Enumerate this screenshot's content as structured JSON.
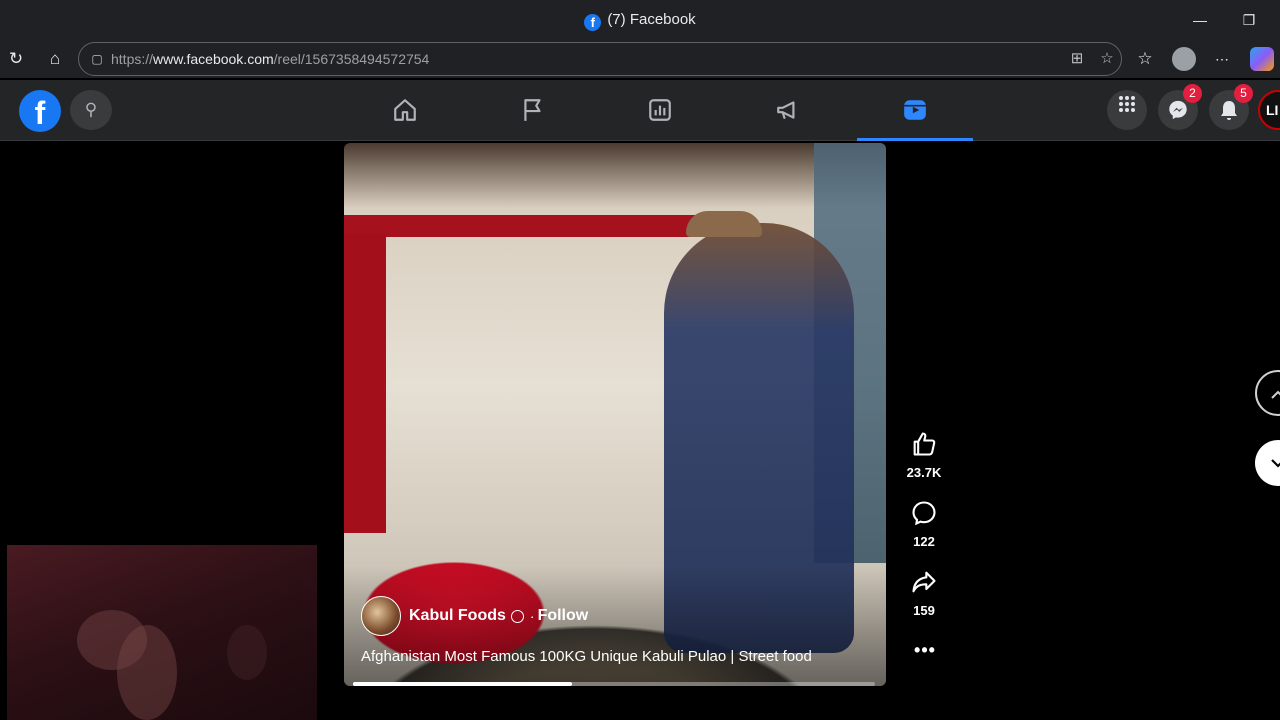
{
  "window": {
    "title": "(7) Facebook",
    "tab_favicon": "facebook-icon"
  },
  "browser": {
    "url_prefix": "https://",
    "url_domain": "www.facebook.com",
    "url_path": "/reel/1567358494572754"
  },
  "fb_header": {
    "messenger_badge": "2",
    "notifications_badge": "5",
    "avatar_initials": "LI"
  },
  "reel": {
    "author": "Kabul Foods",
    "follow_label": "Follow",
    "separator": "·",
    "caption": "Afghanistan Most Famous 100KG Unique Kabuli Pulao | Street food",
    "progress_fraction": 0.42,
    "likes": "23.7K",
    "comments": "122",
    "shares": "159",
    "more_label": "•••"
  },
  "colors": {
    "fb_blue": "#1877f2",
    "badge_red": "#e41e3f",
    "active_tab": "#2d88ff"
  }
}
